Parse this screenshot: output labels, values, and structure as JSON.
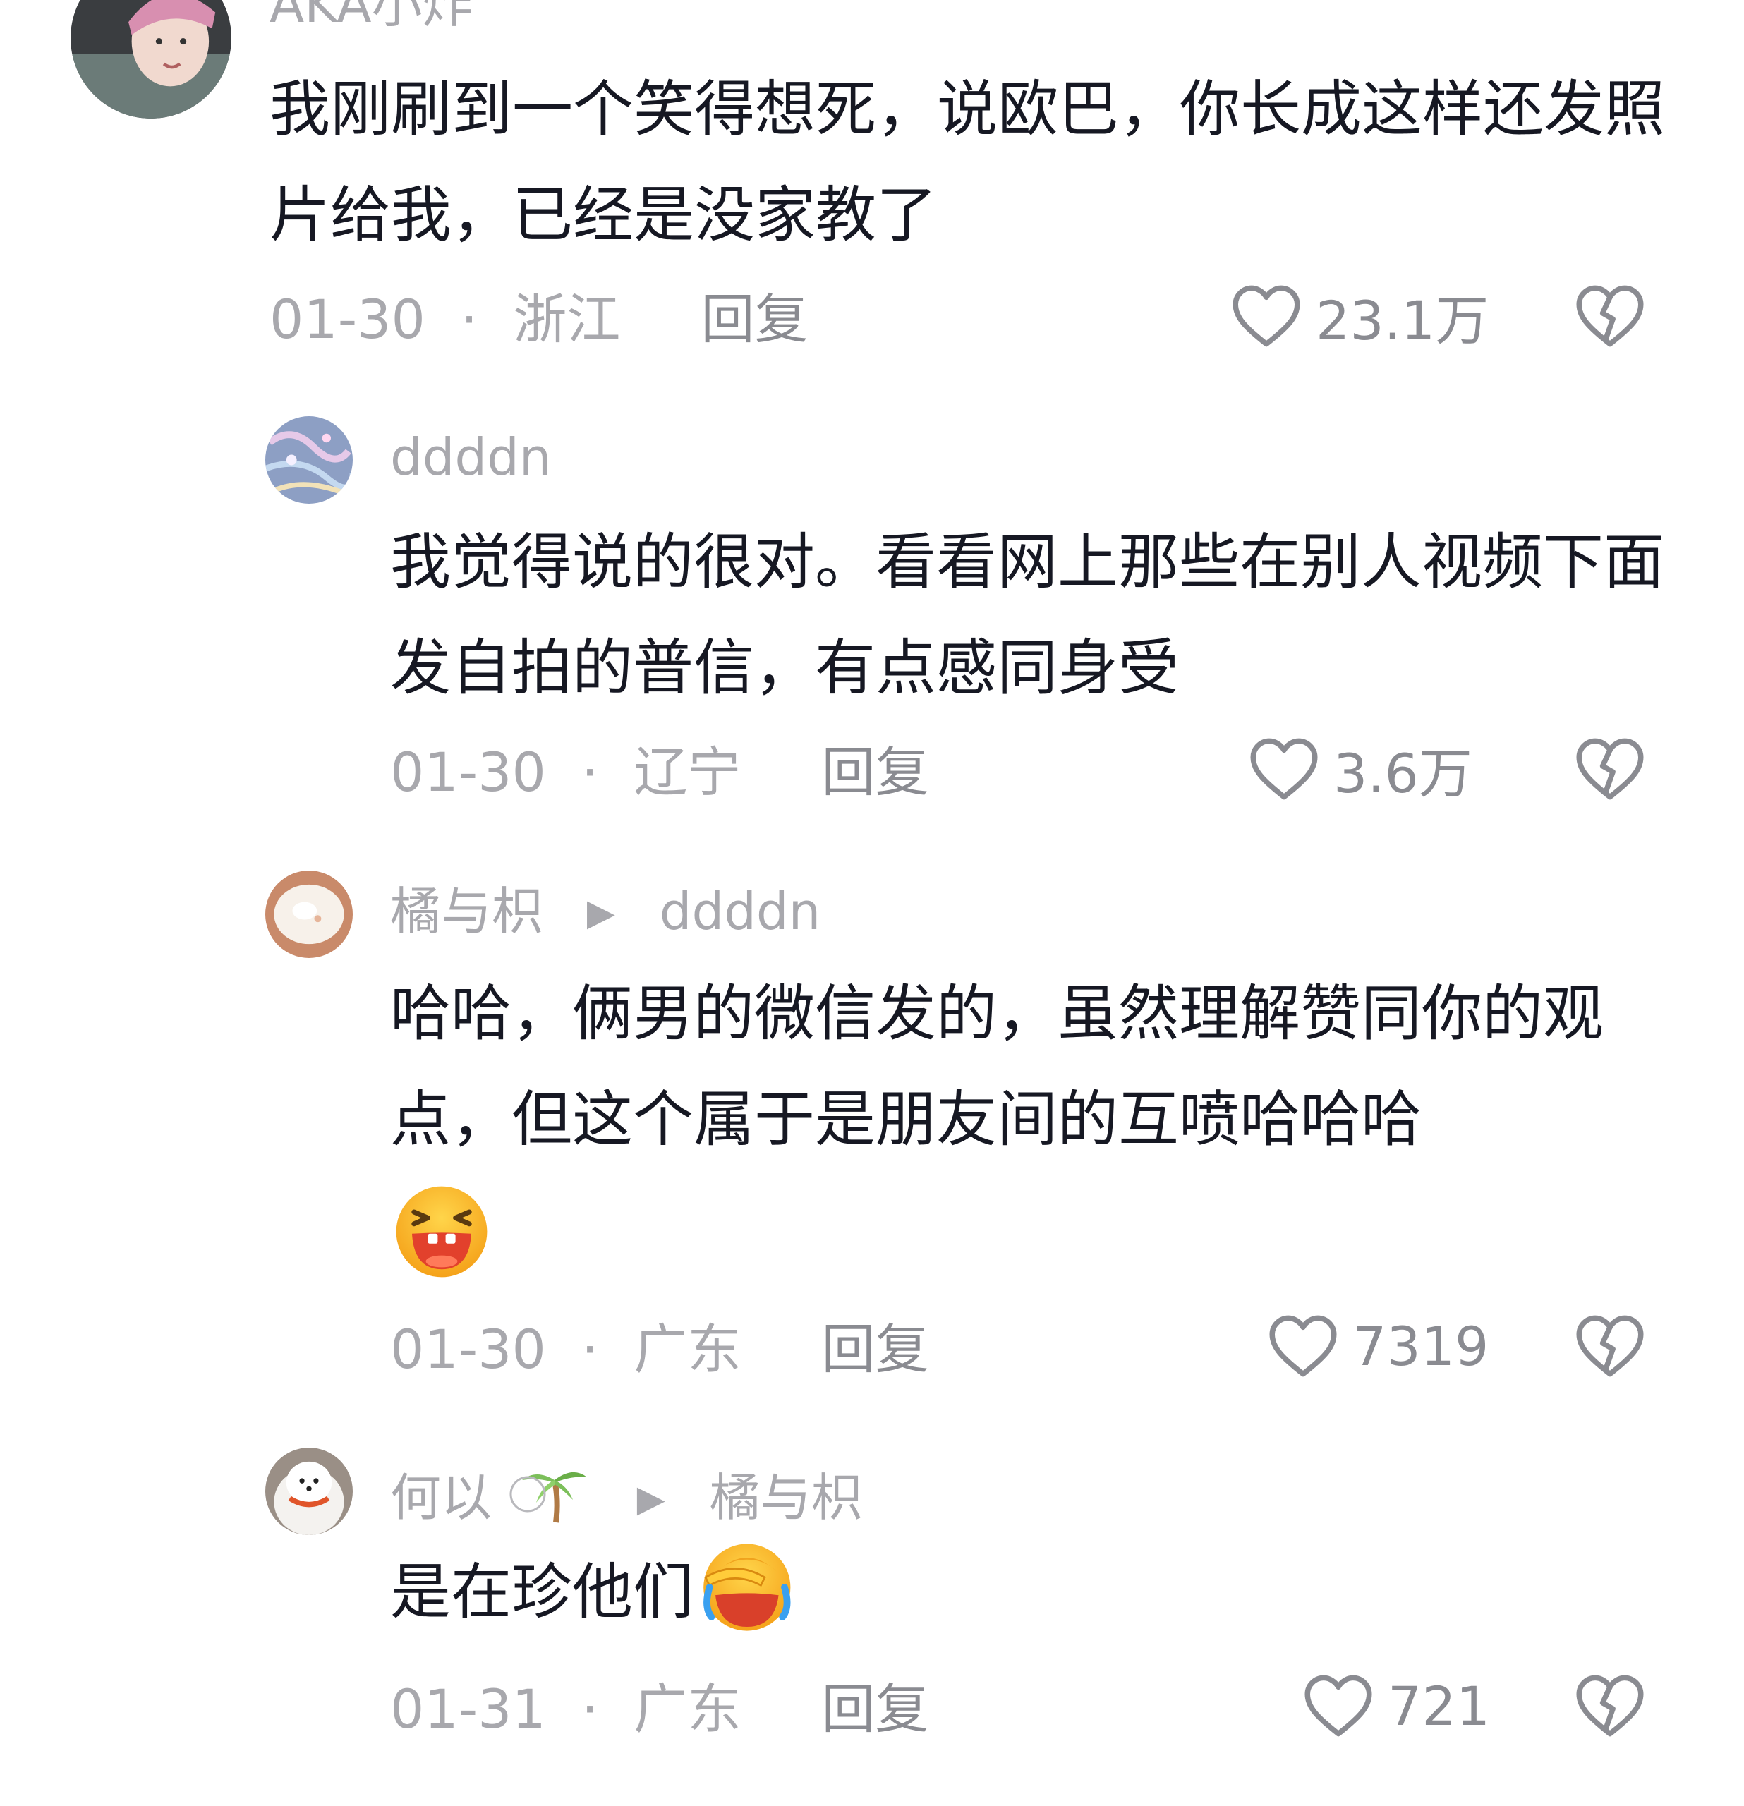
{
  "colors": {
    "text": "#161823",
    "secondary": "#a8a8ad",
    "icon": "#8a8b91",
    "background": "#ffffff"
  },
  "comments": [
    {
      "username": "AKA小炸",
      "text": "我刚刷到一个笑得想死，说欧巴，你长成这样还发照片给我，已经是没家教了",
      "date": "01-30",
      "location": "浙江",
      "reply_label": "回复",
      "likes": "23.1万"
    },
    {
      "username": "ddddn",
      "text": "我觉得说的很对。看看网上那些在别人视频下面发自拍的普信，有点感同身受",
      "date": "01-30",
      "location": "辽宁",
      "reply_label": "回复",
      "likes": "3.6万"
    },
    {
      "username": "橘与枳",
      "reply_to": "ddddn",
      "text": "哈哈，俩男的微信发的，虽然理解赞同你的观点，但这个属于是朋友间的互喷哈哈哈",
      "trailing_emoji": "laughing-emoji",
      "date": "01-30",
      "location": "广东",
      "reply_label": "回复",
      "likes": "7319"
    },
    {
      "username": "何以",
      "username_emoji": "palm-tree-emoji",
      "reply_to": "橘与枳",
      "text": "是在珍他们",
      "trailing_emoji": "facepalm-crying-emoji",
      "date": "01-31",
      "location": "广东",
      "reply_label": "回复",
      "likes": "721"
    }
  ],
  "separator": "·"
}
